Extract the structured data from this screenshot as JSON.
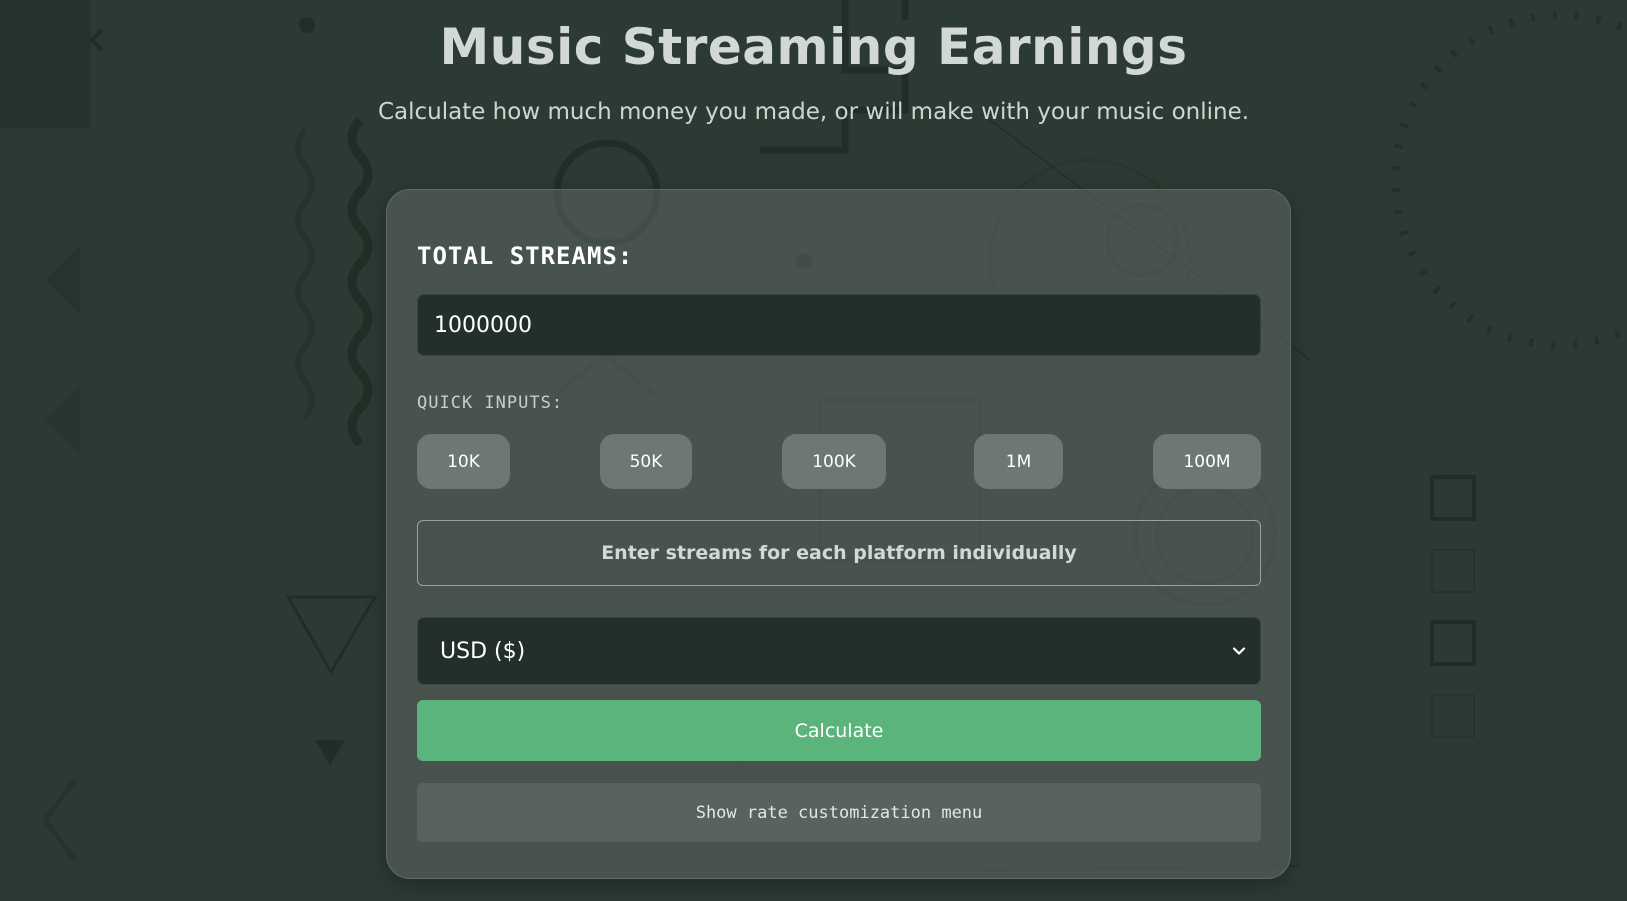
{
  "header": {
    "title": "Music Streaming Earnings",
    "subtitle": "Calculate how much money you made, or will make with your music online."
  },
  "form": {
    "total_streams_label": "TOTAL STREAMS:",
    "total_streams_value": "1000000",
    "quick_inputs_label": "QUICK INPUTS:",
    "quick_inputs": [
      "10K",
      "50K",
      "100K",
      "1M",
      "100M"
    ],
    "platform_toggle_label": "Enter streams for each platform individually",
    "currency_selected": "USD ($)",
    "calculate_label": "Calculate",
    "rate_menu_label": "Show rate customization menu"
  },
  "colors": {
    "background": "#2b3a33",
    "card": "#5f6864",
    "input_bg": "#232f2a",
    "quick_button": "#6d7773",
    "accent": "#5bb47c"
  },
  "icons": {
    "select_arrow": "chevron-down-icon"
  }
}
